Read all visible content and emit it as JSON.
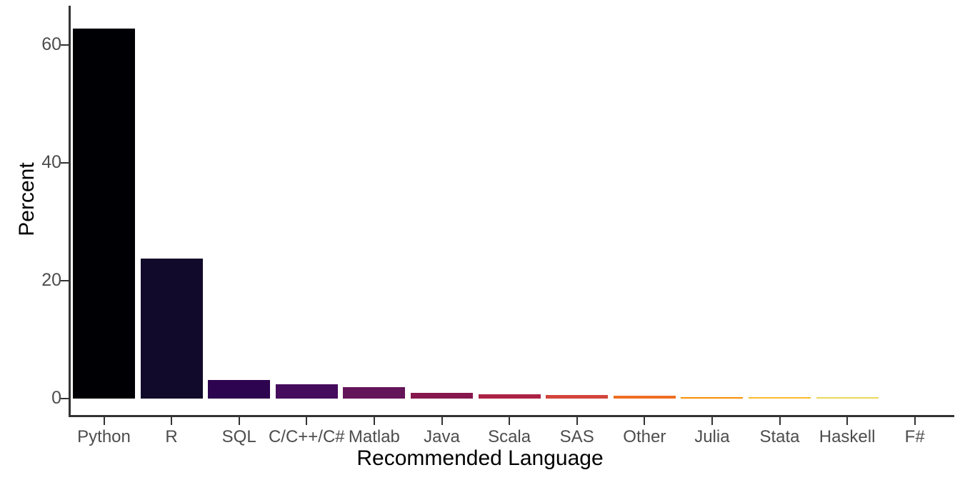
{
  "chart_data": {
    "type": "bar",
    "title": "",
    "subtitle": "",
    "xlabel": "Recommended Language",
    "ylabel": "Percent",
    "categories": [
      "Python",
      "R",
      "SQL",
      "C/C++/C#",
      "Matlab",
      "Java",
      "Scala",
      "SAS",
      "Other",
      "Julia",
      "Stata",
      "Haskell",
      "F#"
    ],
    "values": [
      62.8,
      23.8,
      3.1,
      2.4,
      1.9,
      1.0,
      0.7,
      0.6,
      0.5,
      0.2,
      0.2,
      0.15,
      0.0
    ],
    "colors": [
      "#000004",
      "#120A2A",
      "#2D044F",
      "#450B5C",
      "#641459",
      "#86184E",
      "#AB2245",
      "#D2453B",
      "#EF6E21",
      "#F99006",
      "#F9BC2A",
      "#E9D75A",
      "#FCFFA4"
    ],
    "ylim": [
      0,
      65
    ],
    "xlim_note": "13 discrete categories, evenly spaced",
    "y_ticks": [
      0,
      20,
      40,
      60
    ],
    "y_tick_labels": [
      "0",
      "20",
      "40",
      "60"
    ],
    "grid": false,
    "legend": "none",
    "axis_color": "#333333",
    "tick_label_color": "#4d4d4d",
    "axis_title_color": "#000000",
    "background": "#ffffff"
  },
  "accessibility": {
    "chart_name": "recommended-language-bar-chart"
  }
}
